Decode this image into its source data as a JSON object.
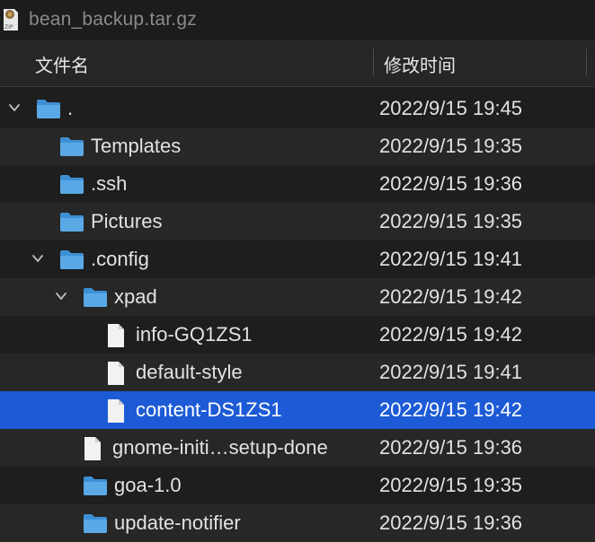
{
  "window": {
    "title": "bean_backup.tar.gz",
    "archive_icon": "zip-archive-icon"
  },
  "header": {
    "name_column": "文件名",
    "date_column": "修改时间"
  },
  "rows": [
    {
      "name": ".",
      "date": "2022/9/15 19:45",
      "type": "folder",
      "depth": 0,
      "expanded": true,
      "selected": false
    },
    {
      "name": "Templates",
      "date": "2022/9/15 19:35",
      "type": "folder",
      "depth": 1,
      "expanded": false,
      "selected": false
    },
    {
      "name": ".ssh",
      "date": "2022/9/15 19:36",
      "type": "folder",
      "depth": 1,
      "expanded": false,
      "selected": false
    },
    {
      "name": "Pictures",
      "date": "2022/9/15 19:35",
      "type": "folder",
      "depth": 1,
      "expanded": false,
      "selected": false
    },
    {
      "name": ".config",
      "date": "2022/9/15 19:41",
      "type": "folder",
      "depth": 1,
      "expanded": true,
      "selected": false
    },
    {
      "name": "xpad",
      "date": "2022/9/15 19:42",
      "type": "folder",
      "depth": 2,
      "expanded": true,
      "selected": false
    },
    {
      "name": "info-GQ1ZS1",
      "date": "2022/9/15 19:42",
      "type": "file",
      "depth": 3,
      "expanded": false,
      "selected": false
    },
    {
      "name": "default-style",
      "date": "2022/9/15 19:41",
      "type": "file",
      "depth": 3,
      "expanded": false,
      "selected": false
    },
    {
      "name": "content-DS1ZS1",
      "date": "2022/9/15 19:42",
      "type": "file",
      "depth": 3,
      "expanded": false,
      "selected": true
    },
    {
      "name": "gnome-initi…setup-done",
      "date": "2022/9/15 19:36",
      "type": "file",
      "depth": 2,
      "expanded": false,
      "selected": false
    },
    {
      "name": "goa-1.0",
      "date": "2022/9/15 19:35",
      "type": "folder",
      "depth": 2,
      "expanded": false,
      "selected": false
    },
    {
      "name": "update-notifier",
      "date": "2022/9/15 19:36",
      "type": "folder",
      "depth": 2,
      "expanded": false,
      "selected": false
    }
  ],
  "colors": {
    "background": "#1e1e1e",
    "row_alt": "#272727",
    "selection": "#1d5bd6",
    "folder": "#5aa9e6",
    "text": "#e2e2e2"
  }
}
